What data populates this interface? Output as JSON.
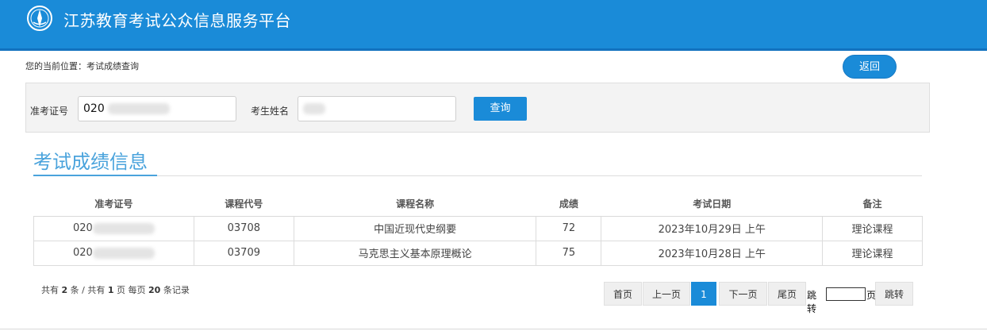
{
  "header": {
    "title": "江苏教育考试公众信息服务平台",
    "logo_icon": "emblem-icon"
  },
  "breadcrumb": "您的当前位置：考试成绩查询",
  "back_label": "返回",
  "search": {
    "id_label": "准考证号",
    "id_value": "020",
    "name_label": "考生姓名",
    "query_label": "查询"
  },
  "section_title": "考试成绩信息",
  "table": {
    "headers": [
      "准考证号",
      "课程代号",
      "课程名称",
      "成绩",
      "考试日期",
      "备注"
    ],
    "rows": [
      {
        "id": "020",
        "code": "03708",
        "name": "中国近现代史纲要",
        "score": "72",
        "date": "2023年10月29日 上午",
        "note": "理论课程"
      },
      {
        "id": "020",
        "code": "03709",
        "name": "马克思主义基本原理概论",
        "score": "75",
        "date": "2023年10月28日 上午",
        "note": "理论课程"
      }
    ]
  },
  "summary": {
    "prefix": "共有",
    "records": "2",
    "mid1": "条 / 共有",
    "pages": "1",
    "mid2": "页 每页",
    "per_page": "20",
    "suffix": "条记录"
  },
  "pager": {
    "first": "首页",
    "prev": "上一页",
    "current": "1",
    "next": "下一页",
    "last": "尾页",
    "jump_prefix": "跳转",
    "jump_suffix": "页",
    "jump_button": "跳转"
  },
  "colors": {
    "header_bg": "#1a8bd8",
    "accent": "#4aa3dc"
  }
}
